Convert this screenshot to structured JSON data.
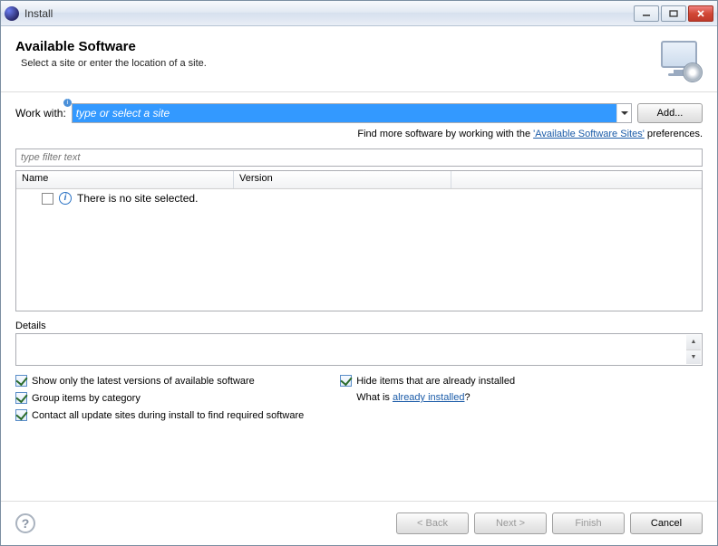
{
  "window": {
    "title": "Install"
  },
  "header": {
    "title": "Available Software",
    "subtitle": "Select a site or enter the location of a site."
  },
  "workWith": {
    "label": "Work with:",
    "placeholder": "type or select a site",
    "addButton": "Add..."
  },
  "findMore": {
    "prefix": "Find more software by working with the ",
    "link": "'Available Software Sites'",
    "suffix": " preferences."
  },
  "filter": {
    "placeholder": "type filter text"
  },
  "columns": {
    "name": "Name",
    "version": "Version"
  },
  "tree": {
    "emptyMessage": "There is no site selected."
  },
  "details": {
    "label": "Details"
  },
  "checkboxes": {
    "latestOnly": "Show only the latest versions of available software",
    "groupByCategory": "Group items by category",
    "contactAllSites": "Contact all update sites during install to find required software",
    "hideInstalled": "Hide items that are already installed",
    "whatIsPrefix": "What is ",
    "whatIsLink": "already installed",
    "whatIsSuffix": "?"
  },
  "buttons": {
    "back": "< Back",
    "next": "Next >",
    "finish": "Finish",
    "cancel": "Cancel"
  }
}
